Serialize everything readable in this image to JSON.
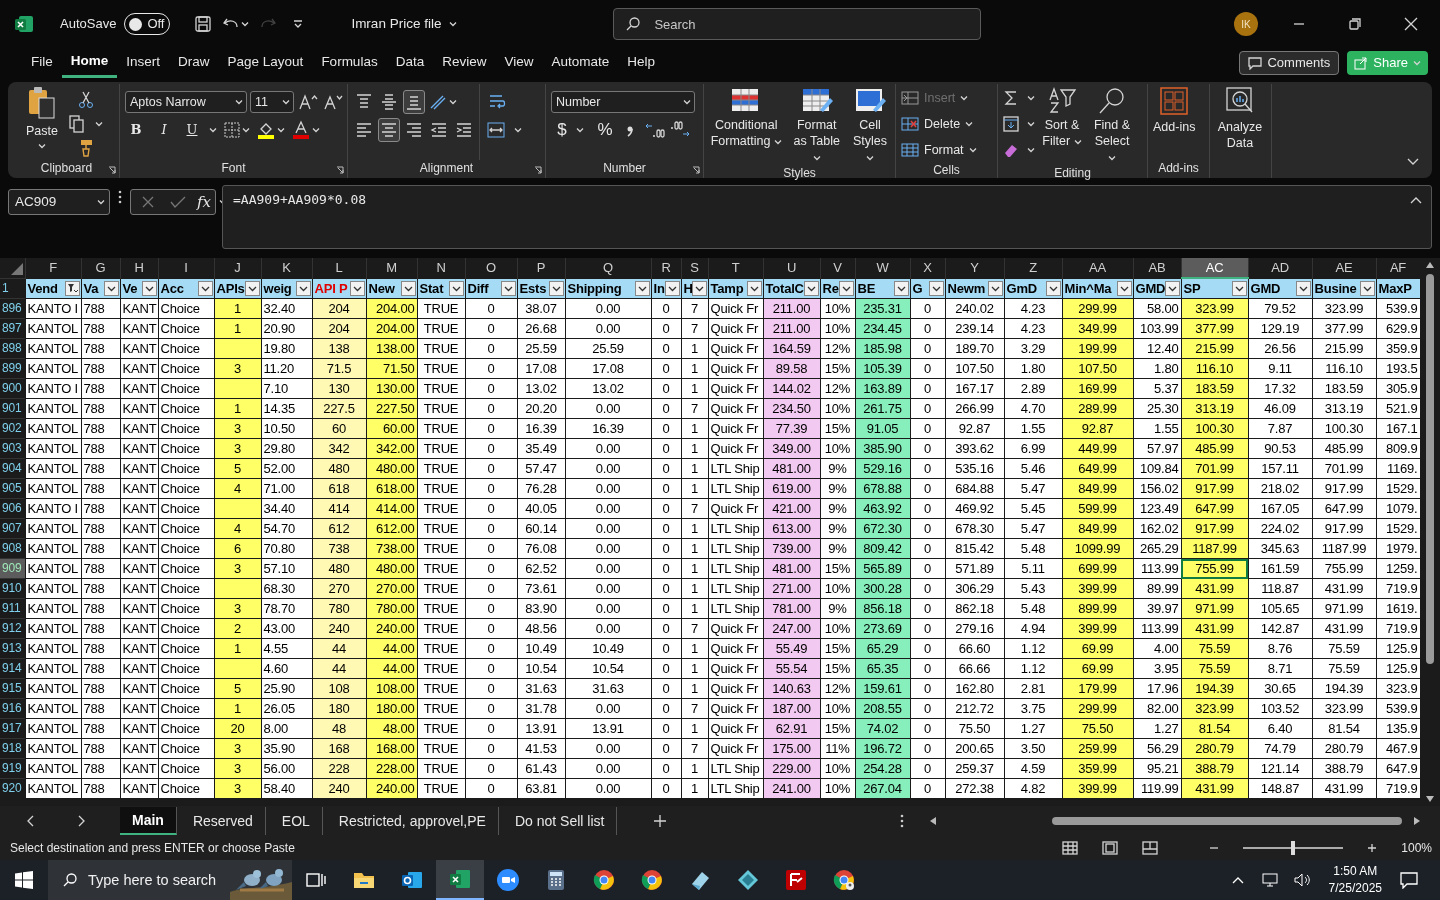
{
  "title_bar": {
    "autosave_label": "AutoSave",
    "autosave_on": false,
    "autosave_state": "Off",
    "file_name": "Imran Price file",
    "search_placeholder": "Search",
    "avatar_initials": "IK"
  },
  "ribbon_tabs": [
    {
      "label": "File",
      "selected": false
    },
    {
      "label": "Home",
      "selected": true
    },
    {
      "label": "Insert",
      "selected": false
    },
    {
      "label": "Draw",
      "selected": false
    },
    {
      "label": "Page Layout",
      "selected": false
    },
    {
      "label": "Formulas",
      "selected": false
    },
    {
      "label": "Data",
      "selected": false
    },
    {
      "label": "Review",
      "selected": false
    },
    {
      "label": "View",
      "selected": false
    },
    {
      "label": "Automate",
      "selected": false
    },
    {
      "label": "Help",
      "selected": false
    }
  ],
  "comments_button": "Comments",
  "share_button": "Share",
  "ribbon": {
    "clipboard": {
      "label": "Clipboard",
      "paste": "Paste"
    },
    "font": {
      "label": "Font",
      "font_name": "Aptos Narrow",
      "font_size": "11",
      "style_buttons": [
        "B",
        "I",
        "U"
      ]
    },
    "alignment": {
      "label": "Alignment",
      "vertical_align": [
        {
          "selected": false
        },
        {
          "selected": false
        },
        {
          "selected": true
        }
      ],
      "horizontal_align": [
        {
          "selected": false
        },
        {
          "selected": true
        },
        {
          "selected": false
        }
      ]
    },
    "number": {
      "label": "Number",
      "format": "Number",
      "buttons": [
        "$",
        "%"
      ]
    },
    "styles": {
      "label": "Styles",
      "buttons": [
        "Conditional Formatting",
        "Format as Table",
        "Cell Styles"
      ]
    },
    "cells": {
      "label": "Cells",
      "buttons": [
        {
          "label": "Insert",
          "disabled": true
        },
        {
          "label": "Delete",
          "disabled": false
        },
        {
          "label": "Format",
          "disabled": false
        }
      ]
    },
    "editing": {
      "label": "Editing",
      "buttons": [
        "Sort & Filter",
        "Find & Select"
      ]
    },
    "addins": {
      "label": "Add-ins",
      "button": "Add-ins"
    },
    "analyze": {
      "button": "Analyze Data"
    }
  },
  "formula_bar": {
    "name_box": "AC909",
    "function_label": "fx",
    "formula": "=AA909+AA909*0.08"
  },
  "sheet": {
    "header_row_number": "1",
    "columns": [
      {
        "letter": "F",
        "header": "Vend",
        "color": "#ffffff",
        "kind": "filtered",
        "selected": false
      },
      {
        "letter": "G",
        "header": "Va",
        "color": "#ffffff",
        "kind": "plain",
        "selected": false
      },
      {
        "letter": "H",
        "header": "Ve",
        "color": "#ffffff",
        "kind": "plain",
        "selected": false
      },
      {
        "letter": "I",
        "header": "Acc",
        "color": "#ffffff",
        "kind": "plain",
        "selected": false
      },
      {
        "letter": "J",
        "header": "APIs",
        "color": "#ffff66",
        "kind": "plain",
        "selected": false
      },
      {
        "letter": "K",
        "header": "weig",
        "color": "#ffffff",
        "kind": "plain",
        "selected": false
      },
      {
        "letter": "L",
        "header": "API P",
        "color": "#fff9b3",
        "kind": "flagged",
        "selected": false
      },
      {
        "letter": "M",
        "header": "New",
        "color": "#ffff66",
        "kind": "plain",
        "selected": false
      },
      {
        "letter": "N",
        "header": "Stat",
        "color": "#ffffff",
        "kind": "plain",
        "selected": false
      },
      {
        "letter": "O",
        "header": "Diff",
        "color": "#ffffff",
        "kind": "plain",
        "selected": false
      },
      {
        "letter": "P",
        "header": "Ests",
        "color": "#ffffff",
        "kind": "plain",
        "selected": false
      },
      {
        "letter": "Q",
        "header": "Shipping",
        "color": "#ffffff",
        "kind": "plain",
        "selected": false
      },
      {
        "letter": "R",
        "header": "In",
        "color": "#ffffff",
        "kind": "plain",
        "selected": false
      },
      {
        "letter": "S",
        "header": "H",
        "color": "#ffffff",
        "kind": "plain",
        "selected": false
      },
      {
        "letter": "T",
        "header": "Tamp",
        "color": "#ffffff",
        "kind": "plain",
        "selected": false
      },
      {
        "letter": "U",
        "header": "TotalC",
        "color": "#f2c9f0",
        "kind": "plain",
        "selected": false
      },
      {
        "letter": "V",
        "header": "Re",
        "color": "#ffffff",
        "kind": "plain",
        "selected": false
      },
      {
        "letter": "W",
        "header": "BE",
        "color": "#86efbb",
        "kind": "plain",
        "selected": false
      },
      {
        "letter": "X",
        "header": "G",
        "color": "#ffffff",
        "kind": "plain",
        "selected": false
      },
      {
        "letter": "Y",
        "header": "Newm",
        "color": "#ffffff",
        "kind": "plain",
        "selected": false
      },
      {
        "letter": "Z",
        "header": "GmD",
        "color": "#ffffff",
        "kind": "plain",
        "selected": false
      },
      {
        "letter": "AA",
        "header": "Min^Ma",
        "color": "#ffff66",
        "kind": "plain",
        "selected": false
      },
      {
        "letter": "AB",
        "header": "GMD",
        "color": "#ffffff",
        "kind": "plain",
        "selected": false
      },
      {
        "letter": "AC",
        "header": "SP",
        "color": "#ffff66",
        "kind": "plain",
        "selected": true
      },
      {
        "letter": "AD",
        "header": "GMD",
        "color": "#ffffff",
        "kind": "plain",
        "selected": false
      },
      {
        "letter": "AE",
        "header": "Busine",
        "color": "#ffffff",
        "kind": "plain",
        "selected": false
      },
      {
        "letter": "AF",
        "header": "MaxP",
        "color": "#ffffff",
        "kind": "plain",
        "selected": false
      }
    ],
    "rows": [
      {
        "number": "896",
        "selected": false,
        "cells": [
          "KANTO I",
          "788",
          "KANT",
          "Choice",
          "1",
          "32.40",
          "204",
          "204.00",
          "TRUE",
          "0",
          "38.07",
          "0.00",
          "0",
          "7",
          "Quick Fr",
          "211.00",
          "10%",
          "235.31",
          "0",
          "240.02",
          "4.23",
          "299.99",
          "58.00",
          "323.99",
          "79.52",
          "323.99",
          "539.9"
        ]
      },
      {
        "number": "897",
        "selected": false,
        "cells": [
          "KANTOL",
          "788",
          "KANT",
          "Choice",
          "1",
          "20.90",
          "204",
          "204.00",
          "TRUE",
          "0",
          "26.68",
          "0.00",
          "0",
          "7",
          "Quick Fr",
          "211.00",
          "10%",
          "234.45",
          "0",
          "239.14",
          "4.23",
          "349.99",
          "103.99",
          "377.99",
          "129.19",
          "377.99",
          "629.9"
        ]
      },
      {
        "number": "898",
        "selected": false,
        "cells": [
          "KANTOL",
          "788",
          "KANT",
          "Choice",
          "",
          "19.80",
          "138",
          "138.00",
          "TRUE",
          "0",
          "25.59",
          "25.59",
          "0",
          "1",
          "Quick Fr",
          "164.59",
          "12%",
          "185.98",
          "0",
          "189.70",
          "3.29",
          "199.99",
          "12.40",
          "215.99",
          "26.56",
          "215.99",
          "359.9"
        ]
      },
      {
        "number": "899",
        "selected": false,
        "cells": [
          "KANTOL",
          "788",
          "KANT",
          "Choice",
          "3",
          "11.20",
          "71.5",
          "71.50",
          "TRUE",
          "0",
          "17.08",
          "17.08",
          "0",
          "1",
          "Quick Fr",
          "89.58",
          "15%",
          "105.39",
          "0",
          "107.50",
          "1.80",
          "107.50",
          "1.80",
          "116.10",
          "9.11",
          "116.10",
          "193.5"
        ]
      },
      {
        "number": "900",
        "selected": false,
        "cells": [
          "KANTO I",
          "788",
          "KANT",
          "Choice",
          "",
          "7.10",
          "130",
          "130.00",
          "TRUE",
          "0",
          "13.02",
          "13.02",
          "0",
          "1",
          "Quick Fr",
          "144.02",
          "12%",
          "163.89",
          "0",
          "167.17",
          "2.89",
          "169.99",
          "5.37",
          "183.59",
          "17.32",
          "183.59",
          "305.9"
        ]
      },
      {
        "number": "901",
        "selected": false,
        "cells": [
          "KANTOL",
          "788",
          "KANT",
          "Choice",
          "1",
          "14.35",
          "227.5",
          "227.50",
          "TRUE",
          "0",
          "20.20",
          "0.00",
          "0",
          "7",
          "Quick Fr",
          "234.50",
          "10%",
          "261.75",
          "0",
          "266.99",
          "4.70",
          "289.99",
          "25.30",
          "313.19",
          "46.09",
          "313.19",
          "521.9"
        ]
      },
      {
        "number": "902",
        "selected": false,
        "cells": [
          "KANTOL",
          "788",
          "KANT",
          "Choice",
          "3",
          "10.50",
          "60",
          "60.00",
          "TRUE",
          "0",
          "16.39",
          "16.39",
          "0",
          "1",
          "Quick Fr",
          "77.39",
          "15%",
          "91.05",
          "0",
          "92.87",
          "1.55",
          "92.87",
          "1.55",
          "100.30",
          "7.87",
          "100.30",
          "167.1"
        ]
      },
      {
        "number": "903",
        "selected": false,
        "cells": [
          "KANTOL",
          "788",
          "KANT",
          "Choice",
          "3",
          "29.80",
          "342",
          "342.00",
          "TRUE",
          "0",
          "35.49",
          "0.00",
          "0",
          "1",
          "Quick Fr",
          "349.00",
          "10%",
          "385.90",
          "0",
          "393.62",
          "6.99",
          "449.99",
          "57.97",
          "485.99",
          "90.53",
          "485.99",
          "809.9"
        ]
      },
      {
        "number": "904",
        "selected": false,
        "cells": [
          "KANTOL",
          "788",
          "KANT",
          "Choice",
          "5",
          "52.00",
          "480",
          "480.00",
          "TRUE",
          "0",
          "57.47",
          "0.00",
          "0",
          "1",
          "LTL Ship",
          "481.00",
          "9%",
          "529.16",
          "0",
          "535.16",
          "5.46",
          "649.99",
          "109.84",
          "701.99",
          "157.11",
          "701.99",
          "1169."
        ]
      },
      {
        "number": "905",
        "selected": false,
        "cells": [
          "KANTOL",
          "788",
          "KANT",
          "Choice",
          "4",
          "71.00",
          "618",
          "618.00",
          "TRUE",
          "0",
          "76.28",
          "0.00",
          "0",
          "1",
          "LTL Ship",
          "619.00",
          "9%",
          "678.88",
          "0",
          "684.88",
          "5.47",
          "849.99",
          "156.02",
          "917.99",
          "218.02",
          "917.99",
          "1529."
        ]
      },
      {
        "number": "906",
        "selected": false,
        "cells": [
          "KANTO I",
          "788",
          "KANT",
          "Choice",
          "",
          "34.40",
          "414",
          "414.00",
          "TRUE",
          "0",
          "40.05",
          "0.00",
          "0",
          "7",
          "Quick Fr",
          "421.00",
          "9%",
          "463.92",
          "0",
          "469.92",
          "5.45",
          "599.99",
          "123.49",
          "647.99",
          "167.05",
          "647.99",
          "1079."
        ]
      },
      {
        "number": "907",
        "selected": false,
        "cells": [
          "KANTOL",
          "788",
          "KANT",
          "Choice",
          "4",
          "54.70",
          "612",
          "612.00",
          "TRUE",
          "0",
          "60.14",
          "0.00",
          "0",
          "1",
          "LTL Ship",
          "613.00",
          "9%",
          "672.30",
          "0",
          "678.30",
          "5.47",
          "849.99",
          "162.02",
          "917.99",
          "224.02",
          "917.99",
          "1529."
        ]
      },
      {
        "number": "908",
        "selected": false,
        "cells": [
          "KANTOL",
          "788",
          "KANT",
          "Choice",
          "6",
          "70.80",
          "738",
          "738.00",
          "TRUE",
          "0",
          "76.08",
          "0.00",
          "0",
          "1",
          "LTL Ship",
          "739.00",
          "9%",
          "809.42",
          "0",
          "815.42",
          "5.48",
          "1099.99",
          "265.29",
          "1187.99",
          "345.63",
          "1187.99",
          "1979."
        ]
      },
      {
        "number": "909",
        "selected": true,
        "cells": [
          "KANTOL",
          "788",
          "KANT",
          "Choice",
          "3",
          "57.10",
          "480",
          "480.00",
          "TRUE",
          "0",
          "62.52",
          "0.00",
          "0",
          "1",
          "LTL Ship",
          "481.00",
          "15%",
          "565.89",
          "0",
          "571.89",
          "5.11",
          "699.99",
          "113.99",
          "755.99",
          "161.59",
          "755.99",
          "1259."
        ]
      },
      {
        "number": "910",
        "selected": false,
        "cells": [
          "KANTOL",
          "788",
          "KANT",
          "Choice",
          "",
          "68.30",
          "270",
          "270.00",
          "TRUE",
          "0",
          "73.61",
          "0.00",
          "0",
          "1",
          "LTL Ship",
          "271.00",
          "10%",
          "300.28",
          "0",
          "306.29",
          "5.43",
          "399.99",
          "89.99",
          "431.99",
          "118.87",
          "431.99",
          "719.9"
        ]
      },
      {
        "number": "911",
        "selected": false,
        "cells": [
          "KANTOL",
          "788",
          "KANT",
          "Choice",
          "3",
          "78.70",
          "780",
          "780.00",
          "TRUE",
          "0",
          "83.90",
          "0.00",
          "0",
          "1",
          "LTL Ship",
          "781.00",
          "9%",
          "856.18",
          "0",
          "862.18",
          "5.48",
          "899.99",
          "39.97",
          "971.99",
          "105.65",
          "971.99",
          "1619."
        ]
      },
      {
        "number": "912",
        "selected": false,
        "cells": [
          "KANTOL",
          "788",
          "KANT",
          "Choice",
          "2",
          "43.00",
          "240",
          "240.00",
          "TRUE",
          "0",
          "48.56",
          "0.00",
          "0",
          "7",
          "Quick Fr",
          "247.00",
          "10%",
          "273.69",
          "0",
          "279.16",
          "4.94",
          "399.99",
          "113.99",
          "431.99",
          "142.87",
          "431.99",
          "719.9"
        ]
      },
      {
        "number": "913",
        "selected": false,
        "cells": [
          "KANTOL",
          "788",
          "KANT",
          "Choice",
          "1",
          "4.55",
          "44",
          "44.00",
          "TRUE",
          "0",
          "10.49",
          "10.49",
          "0",
          "1",
          "Quick Fr",
          "55.49",
          "15%",
          "65.29",
          "0",
          "66.60",
          "1.12",
          "69.99",
          "4.00",
          "75.59",
          "8.76",
          "75.59",
          "125.9"
        ]
      },
      {
        "number": "914",
        "selected": false,
        "cells": [
          "KANTOL",
          "788",
          "KANT",
          "Choice",
          "",
          "4.60",
          "44",
          "44.00",
          "TRUE",
          "0",
          "10.54",
          "10.54",
          "0",
          "1",
          "Quick Fr",
          "55.54",
          "15%",
          "65.35",
          "0",
          "66.66",
          "1.12",
          "69.99",
          "3.95",
          "75.59",
          "8.71",
          "75.59",
          "125.9"
        ]
      },
      {
        "number": "915",
        "selected": false,
        "cells": [
          "KANTOL",
          "788",
          "KANT",
          "Choice",
          "5",
          "25.90",
          "108",
          "108.00",
          "TRUE",
          "0",
          "31.63",
          "31.63",
          "0",
          "1",
          "Quick Fr",
          "140.63",
          "12%",
          "159.61",
          "0",
          "162.80",
          "2.81",
          "179.99",
          "17.96",
          "194.39",
          "30.65",
          "194.39",
          "323.9"
        ]
      },
      {
        "number": "916",
        "selected": false,
        "cells": [
          "KANTOL",
          "788",
          "KANT",
          "Choice",
          "1",
          "26.05",
          "180",
          "180.00",
          "TRUE",
          "0",
          "31.78",
          "0.00",
          "0",
          "7",
          "Quick Fr",
          "187.00",
          "10%",
          "208.55",
          "0",
          "212.72",
          "3.75",
          "299.99",
          "82.00",
          "323.99",
          "103.52",
          "323.99",
          "539.9"
        ]
      },
      {
        "number": "917",
        "selected": false,
        "cells": [
          "KANTOL",
          "788",
          "KANT",
          "Choice",
          "20",
          "8.00",
          "48",
          "48.00",
          "TRUE",
          "0",
          "13.91",
          "13.91",
          "0",
          "1",
          "Quick Fr",
          "62.91",
          "15%",
          "74.02",
          "0",
          "75.50",
          "1.27",
          "75.50",
          "1.27",
          "81.54",
          "6.40",
          "81.54",
          "135.9"
        ]
      },
      {
        "number": "918",
        "selected": false,
        "cells": [
          "KANTOL",
          "788",
          "KANT",
          "Choice",
          "3",
          "35.90",
          "168",
          "168.00",
          "TRUE",
          "0",
          "41.53",
          "0.00",
          "0",
          "7",
          "Quick Fr",
          "175.00",
          "11%",
          "196.72",
          "0",
          "200.65",
          "3.50",
          "259.99",
          "56.29",
          "280.79",
          "74.79",
          "280.79",
          "467.9"
        ]
      },
      {
        "number": "919",
        "selected": false,
        "cells": [
          "KANTOL",
          "788",
          "KANT",
          "Choice",
          "3",
          "56.00",
          "228",
          "228.00",
          "TRUE",
          "0",
          "61.43",
          "0.00",
          "0",
          "1",
          "LTL Ship",
          "229.00",
          "10%",
          "254.28",
          "0",
          "259.37",
          "4.59",
          "359.99",
          "95.21",
          "388.79",
          "121.14",
          "388.79",
          "647.9"
        ]
      },
      {
        "number": "920",
        "selected": false,
        "cells": [
          "KANTOL",
          "788",
          "KANT",
          "Choice",
          "3",
          "58.40",
          "240",
          "240.00",
          "TRUE",
          "0",
          "63.81",
          "0.00",
          "0",
          "1",
          "LTL Ship",
          "241.00",
          "10%",
          "267.04",
          "0",
          "272.38",
          "4.82",
          "399.99",
          "119.99",
          "431.99",
          "148.87",
          "431.99",
          "719.9"
        ]
      }
    ]
  },
  "sheet_tabs": [
    {
      "label": "Main",
      "selected": true
    },
    {
      "label": "Reserved",
      "selected": false
    },
    {
      "label": "EOL",
      "selected": false
    },
    {
      "label": "Restricted, approvel,PE",
      "selected": false
    },
    {
      "label": "Do not Sell list",
      "selected": false
    }
  ],
  "status_bar": {
    "message": "Select destination and press ENTER or choose Paste",
    "zoom": {
      "label": "100%",
      "level": 0.5
    }
  },
  "taskbar": {
    "search_placeholder": "Type here to search",
    "time": "1:50 AM",
    "date": "7/25/2025"
  }
}
